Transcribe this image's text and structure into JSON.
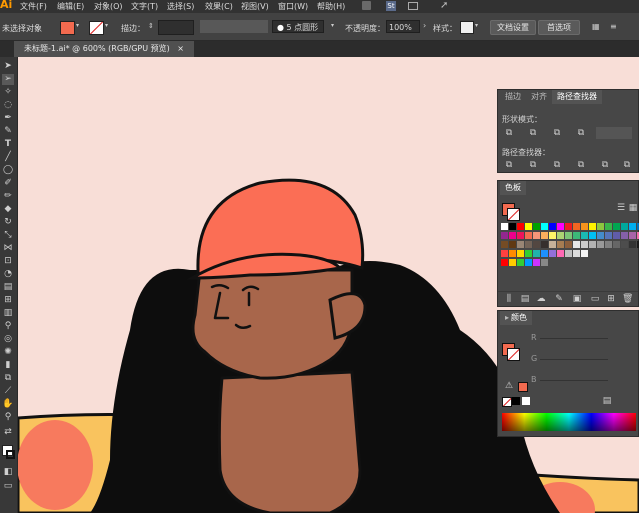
{
  "app": {
    "logo": "Ai"
  },
  "menu": [
    "文件(F)",
    "编辑(E)",
    "对象(O)",
    "文字(T)",
    "选择(S)",
    "效果(C)",
    "视图(V)",
    "窗口(W)",
    "帮助(H)"
  ],
  "menu_icons": {
    "st_badge": "St"
  },
  "control_bar": {
    "selection_label": "未选择对象",
    "stroke_label": "描边：",
    "brush_label": "5 点圆形",
    "opacity_label": "不透明度：",
    "opacity_value": "100%",
    "style_label": "样式：",
    "doc_setup_button": "文档设置",
    "preferences_button": "首选项",
    "fill_color": "#f26a4f"
  },
  "document_tab": {
    "title": "未标题-1.ai* @ 600% (RGB/GPU 预览)",
    "close": "×"
  },
  "pathfinder_panel": {
    "tabs": [
      "描边",
      "对齐",
      "路径查找器"
    ],
    "shape_modes_label": "形状模式：",
    "pathfinders_label": "路径查找器："
  },
  "swatches_panel": {
    "title": "色板"
  },
  "color_panel": {
    "title": "颜色",
    "channels": [
      "R",
      "G",
      "B"
    ],
    "fill_color": "#f26a4f"
  },
  "colors": {
    "canvas": "#f8ded7",
    "hat": "#fb6e55",
    "skin": "#a8664b",
    "hair": "#0d0d0d",
    "shirt": "#f9c35e",
    "dots": "#f77a5e"
  }
}
